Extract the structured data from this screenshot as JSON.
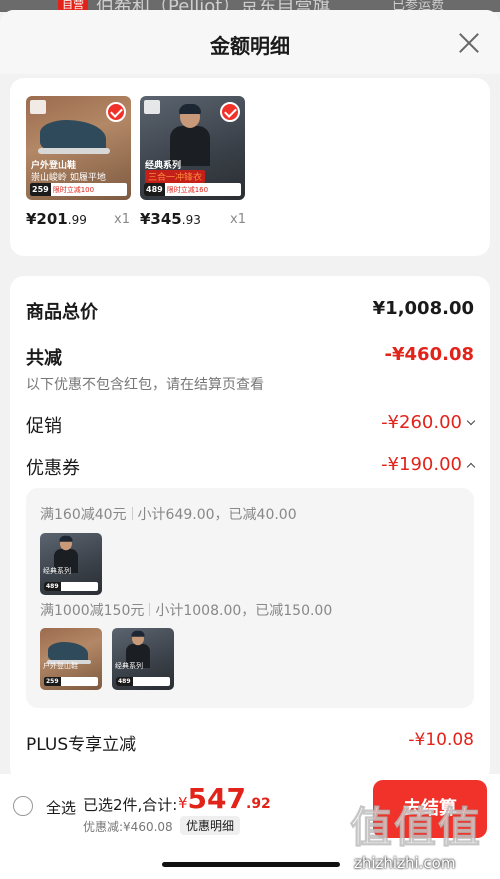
{
  "backdrop": {
    "tag": "自营",
    "title": "伯希和（Pelliot）京东自营旗",
    "side": "已参运费"
  },
  "header": {
    "title": "金额明细"
  },
  "products": [
    {
      "image": "hiking-shoe-image",
      "caption1": "户外登山鞋",
      "caption2": "崇山峻岭 如履平地",
      "price_tag": "259",
      "price_tag_label": "限时立减100",
      "price_int": "¥201",
      "price_dec": ".99",
      "qty": "x1"
    },
    {
      "image": "jacket-image",
      "caption1": "经典系列",
      "caption2": "三合一冲锋衣",
      "price_tag": "489",
      "price_tag_label": "限时立减160",
      "price_int": "¥345",
      "price_dec": ".93",
      "qty": "x1"
    }
  ],
  "details": {
    "goods_total_label": "商品总价",
    "goods_total_value": "¥1,008.00",
    "reduce_label": "共减",
    "reduce_value": "-¥460.08",
    "reduce_note": "以下优惠不包含红包，请在结算页查看",
    "promo_label": "促销",
    "promo_value": "-¥260.00",
    "coupon_label": "优惠券",
    "coupon_value": "-¥190.00",
    "coupon_rules": [
      {
        "rule": "满160减40元",
        "detail": "小计649.00，已减40.00"
      },
      {
        "rule": "满1000减150元",
        "detail": "小计1008.00，已减150.00"
      }
    ],
    "mini_caption_jacket": "经典系列",
    "mini_caption_shoe": "户外登山鞋",
    "mini_tag_jacket": "489",
    "mini_tag_shoe": "259",
    "plus_label": "PLUS专享立减",
    "plus_value": "-¥10.08"
  },
  "footer": {
    "select_all": "全选",
    "summary": "已选2件,合计:",
    "total_currency": "¥",
    "total_int": "547",
    "total_dec": ".92",
    "saved": "优惠减:¥460.08",
    "detail_button": "优惠明细",
    "checkout": "去结算"
  },
  "watermark": {
    "glyphs": "值值值",
    "url": "zhizhizhi.com"
  },
  "colors": {
    "accent": "#f0322b",
    "price_red": "#e2231a"
  }
}
